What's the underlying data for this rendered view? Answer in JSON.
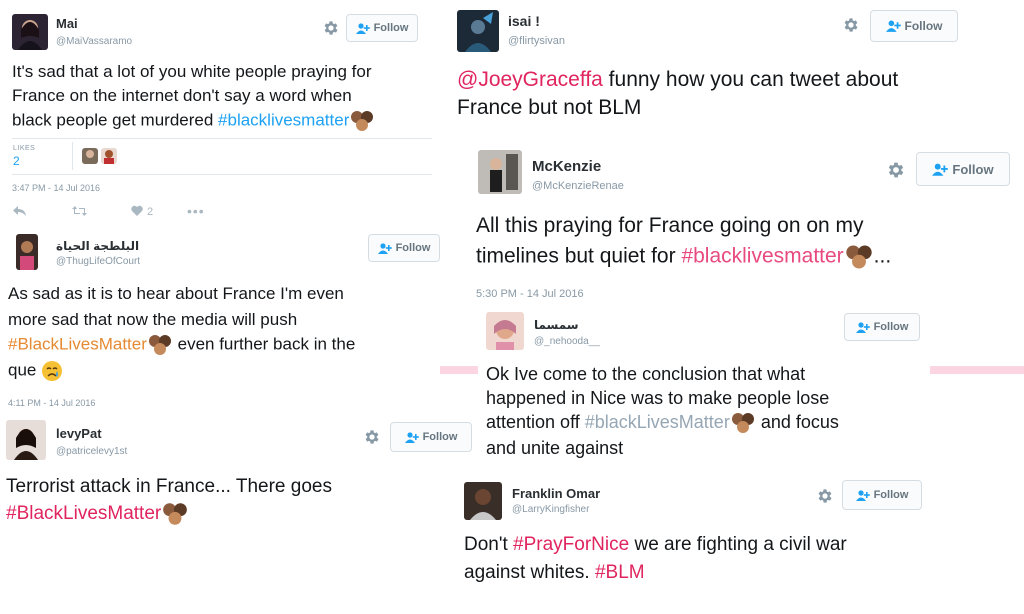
{
  "tweets": {
    "mai": {
      "name": "Mai",
      "handle": "@MaiVassaramo",
      "follow": "Follow",
      "text1": "It's sad that a lot of you white people praying for",
      "text2": "France on the internet don't say a word when",
      "text3_pre": "black people get murdered ",
      "hashtag": "#blacklivesmatter",
      "likes_label": "LIKES",
      "likes_count": "2",
      "timestamp": "3:47 PM - 14 Jul 2016",
      "heart_count": "2"
    },
    "court": {
      "name": "البلطجة الحياة",
      "handle": "@ThugLifeOfCourt",
      "follow": "Follow",
      "text1": "As sad as it is to hear about France I'm even",
      "text2": "more sad that now the media will push",
      "hashtag": "#BlackLivesMatter",
      "text3_post": " even further back in the",
      "text4": "que",
      "timestamp": "4:11 PM - 14 Jul 2016"
    },
    "levy": {
      "name": "levyPat",
      "handle": "@patricelevy1st",
      "follow": "Follow",
      "text1": "Terrorist attack in France... There goes",
      "hashtag": "#BlackLivesMatter"
    },
    "isai": {
      "name": "isai !",
      "handle": "@flirtysivan",
      "follow": "Follow",
      "mention": "@JoeyGraceffa",
      "text1_post": " funny how you can tweet about",
      "text2": "France but not BLM"
    },
    "mckenzie": {
      "name": "McKenzie",
      "handle": "@McKenzieRenae",
      "follow": "Follow",
      "text1": "All this praying for France going on on my",
      "text2_pre": "timelines but quiet for ",
      "hashtag": "#blacklivesmatter",
      "ellipsis": "...",
      "timestamp": "5:30 PM - 14 Jul 2016"
    },
    "nehooda": {
      "name": "سمسما",
      "handle": "@_nehooda__",
      "follow": "Follow",
      "text1": "Ok Ive come to the conclusion that what",
      "text2": "happened in Nice was to make people lose",
      "text3_pre": "attention off ",
      "hashtag": "#blackLivesMatter",
      "text3_post": " and focus",
      "text4": "and unite against"
    },
    "franklin": {
      "name": "Franklin Omar",
      "handle": "@LarryKingfisher",
      "follow": "Follow",
      "text1_pre": "Don't ",
      "hashtag1": "#PrayForNice",
      "text1_post": " we are fighting a civil war",
      "text2_pre": "against whites. ",
      "hashtag2": "#BLM"
    }
  },
  "icons": {
    "gear": "gear-icon",
    "follow": "add-user-icon",
    "reply": "reply-icon",
    "retweet": "retweet-icon",
    "like": "heart-icon",
    "more": "more-icon",
    "fist": "raised-fists-emoji",
    "crying": "crying-face-emoji"
  },
  "colors": {
    "hashtag_blue": "#1da1f2",
    "hashtag_pink": "#e0245e",
    "hashtag_orange": "#e58a32",
    "handle_gray": "#8899a6"
  }
}
